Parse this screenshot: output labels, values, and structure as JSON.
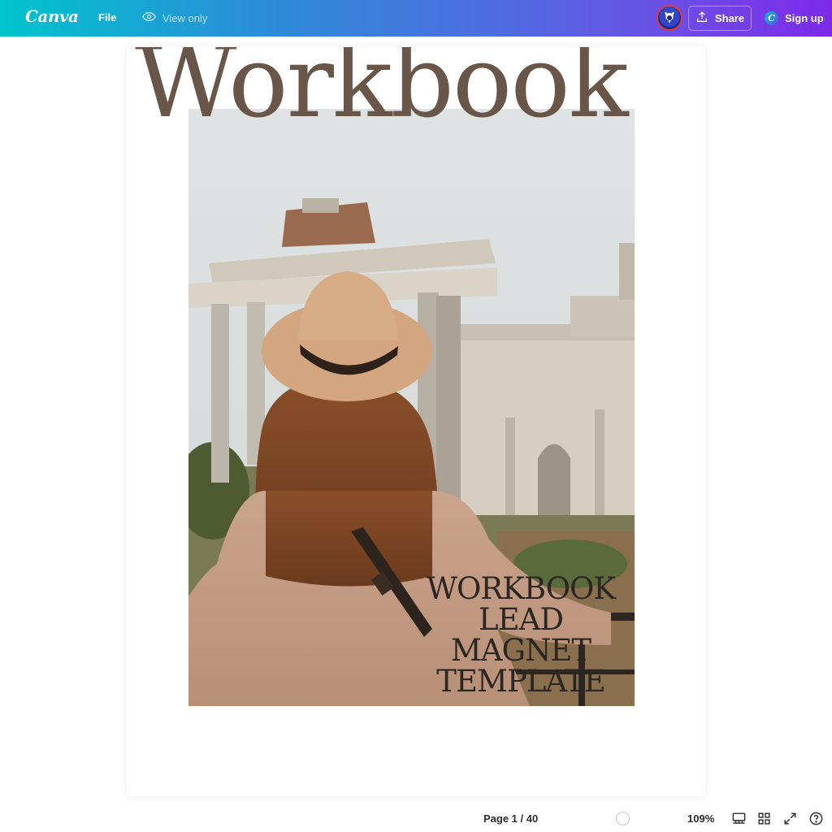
{
  "topbar": {
    "logo": "Canva",
    "file_label": "File",
    "view_only_label": "View only",
    "share_label": "Share",
    "signup_label": "Sign up",
    "signup_badge": "C"
  },
  "document": {
    "title": "Workbook",
    "subtitle_lines": [
      "WORKBOOK",
      "LEAD",
      "MAGNET",
      "TEMPLATE"
    ]
  },
  "bottombar": {
    "page_indicator": "Page 1 / 40",
    "zoom": "109%"
  },
  "icons": {
    "view_only": "eye-icon",
    "share": "upload-icon",
    "layout": "notes-layout-icon",
    "grid": "grid-view-icon",
    "fullscreen": "fullscreen-icon",
    "help": "help-icon"
  },
  "colors": {
    "gradient_start": "#00c4cc",
    "gradient_end": "#7d2ae8",
    "title_color": "#6a5648",
    "subtitle_color": "#2b2622"
  }
}
